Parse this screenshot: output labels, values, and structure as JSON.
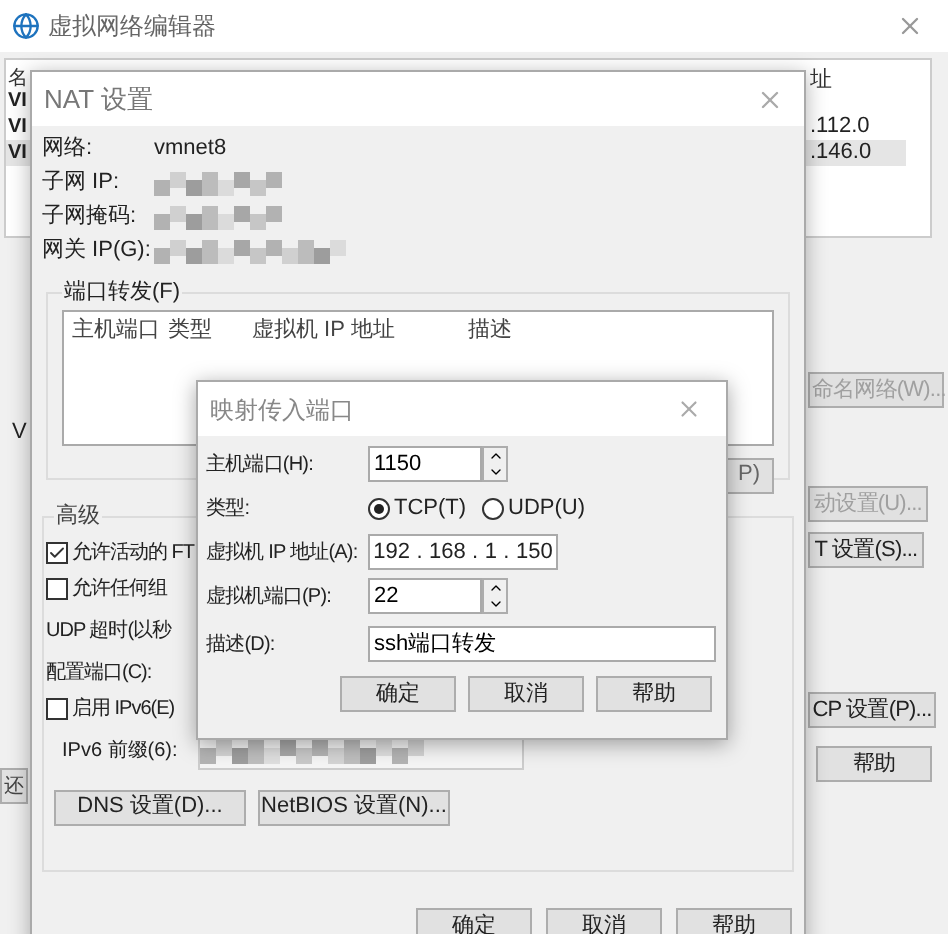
{
  "main_window": {
    "title": "虚拟网络编辑器",
    "list_header": {
      "column_1": "名",
      "column_2": "址"
    },
    "rows": [
      {
        "column_1": "VI",
        "selected": false
      },
      {
        "column_1": "VI",
        "column_2": ".112.0",
        "selected": false
      },
      {
        "column_1": "VI",
        "column_2": ".146.0",
        "selected": true
      }
    ],
    "side_label": "V",
    "left_button": "还",
    "right_buttons": [
      {
        "label": "命名网络(W)...",
        "disabled": true
      },
      {
        "label": "动设置(U)...",
        "disabled": true
      },
      {
        "label": "T 设置(S)...",
        "disabled": false
      },
      {
        "label": "CP 设置(P)...",
        "disabled": false
      },
      {
        "label": "帮助",
        "disabled": false
      }
    ]
  },
  "nat_dialog": {
    "title": "NAT 设置",
    "info": [
      {
        "label": "网络:",
        "value": "vmnet8"
      },
      {
        "label": "子网 IP:",
        "redacted": true
      },
      {
        "label": "子网掩码:",
        "redacted": true
      },
      {
        "label": "网关 IP(G):",
        "redacted": true
      }
    ],
    "port_forwarding": {
      "title": "端口转发(F)",
      "columns": [
        "主机端口",
        "类型",
        "虚拟机 IP 地址",
        "描述"
      ],
      "button": "P)"
    },
    "advanced": {
      "title": "高级",
      "items": [
        {
          "kind": "checkbox",
          "label": "允许活动的 FT",
          "checked": true
        },
        {
          "kind": "checkbox",
          "label": "允许任何组",
          "checked": false
        },
        {
          "kind": "text",
          "label": "UDP 超时(以秒"
        },
        {
          "kind": "text",
          "label": "配置端口(C):"
        },
        {
          "kind": "checkbox",
          "label": "启用 IPv6(E)",
          "checked": false
        },
        {
          "kind": "field",
          "label": "IPv6 前缀(6):",
          "redacted": true
        }
      ],
      "buttons": [
        "DNS 设置(D)...",
        "NetBIOS 设置(N)..."
      ]
    },
    "buttons": [
      "确定",
      "取消",
      "帮助"
    ]
  },
  "map_dialog": {
    "title": "映射传入端口",
    "host_port": {
      "label": "主机端口(H):",
      "value": "1150"
    },
    "type": {
      "label": "类型:",
      "options": [
        {
          "label": "TCP(T)",
          "selected": true
        },
        {
          "label": "UDP(U)",
          "selected": false
        }
      ]
    },
    "vm_ip": {
      "label": "虚拟机 IP 地址(A):",
      "octets": [
        "192",
        "168",
        "1",
        "150"
      ],
      "separator": "."
    },
    "vm_port": {
      "label": "虚拟机端口(P):",
      "value": "22"
    },
    "description": {
      "label": "描述(D):",
      "value": "ssh端口转发"
    },
    "buttons": [
      "确定",
      "取消",
      "帮助"
    ]
  }
}
